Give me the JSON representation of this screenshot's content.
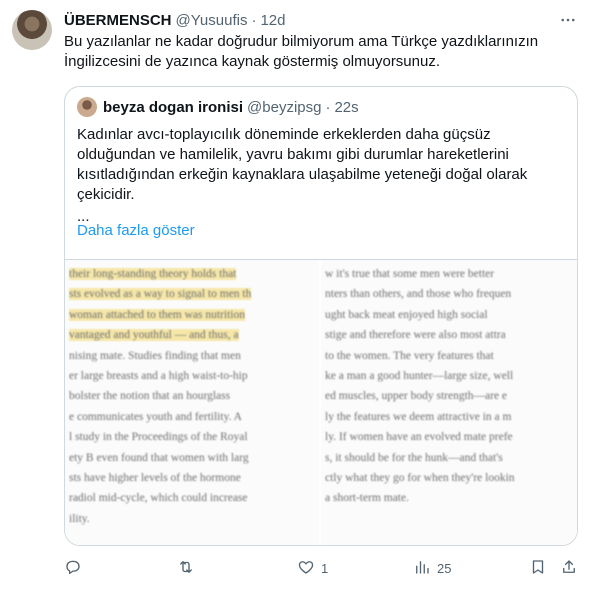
{
  "tweet": {
    "author": "ÜBERMENSCH",
    "handle": "@Yusuufis",
    "separator": "·",
    "time": "12d",
    "more_icon": "more-horizontal-icon",
    "text": "Bu yazılanlar ne kadar doğrudur bilmiyorum ama Türkçe yazdıklarınızın İngilizcesini de yazınca kaynak göstermiş olmuyorsunuz."
  },
  "quote": {
    "author": "beyza dogan ironisi",
    "handle": "@beyzipsg",
    "separator": "·",
    "time": "22s",
    "text": "Kadınlar avcı-toplayıcılık döneminde erkeklerden daha güçsüz olduğundan ve hamilelik, yavru bakımı gibi durumlar hareketlerini kısıtladığından erkeğin kaynaklara ulaşabilme yeteneği doğal olarak çekicidir.",
    "ellipsis": "...",
    "show_more": "Daha fazla göster",
    "media_left_lines": [
      {
        "text": "their long-standing theory holds that",
        "hl": true
      },
      {
        "text": "sts evolved as a way to signal to men th",
        "hl": true
      },
      {
        "text": "woman attached to them was nutrition",
        "hl": true
      },
      {
        "text": "vantaged and youthful — and thus, a",
        "hl": true
      },
      {
        "text": "nising mate. Studies finding that men",
        "hl": false
      },
      {
        "text": "er large breasts and a high waist-to-hip",
        "hl": false
      },
      {
        "text": "bolster the notion that an hourglass",
        "hl": false
      },
      {
        "text": "e communicates youth and fertility. A",
        "hl": false
      },
      {
        "text": "l study in the Proceedings of the Royal",
        "hl": false
      },
      {
        "text": "ety B even found that women with larg",
        "hl": false
      },
      {
        "text": "sts have higher levels of the hormone",
        "hl": false
      },
      {
        "text": "radiol mid-cycle, which could increase",
        "hl": false
      },
      {
        "text": "ility.",
        "hl": false
      }
    ],
    "media_right_lines": [
      "w it's true that some men were better",
      "nters than others, and those who frequen",
      "ught back meat enjoyed high social",
      "stige and therefore were also most attra",
      "to the women. The very features that",
      "ke a man a good hunter—large size, well",
      "ed muscles, upper body strength—are e",
      "ly the features we deem attractive in a m",
      "ly. If women have an evolved mate prefe",
      "s, it should be for the hunk—and that's",
      "ctly what they go for when they're lookin",
      "a short-term mate."
    ]
  },
  "actions": {
    "reply": {
      "icon": "reply-icon",
      "count": ""
    },
    "retweet": {
      "icon": "retweet-icon",
      "count": ""
    },
    "like": {
      "icon": "heart-icon",
      "count": "1"
    },
    "views": {
      "icon": "views-chart-icon",
      "count": "25"
    },
    "bookmark": {
      "icon": "bookmark-icon",
      "count": ""
    },
    "share": {
      "icon": "share-icon",
      "count": ""
    }
  },
  "colors": {
    "accent": "#1d9bf0",
    "secondary_text": "#536471",
    "border": "#cfd9de",
    "highlight": "#f6e7a8"
  }
}
